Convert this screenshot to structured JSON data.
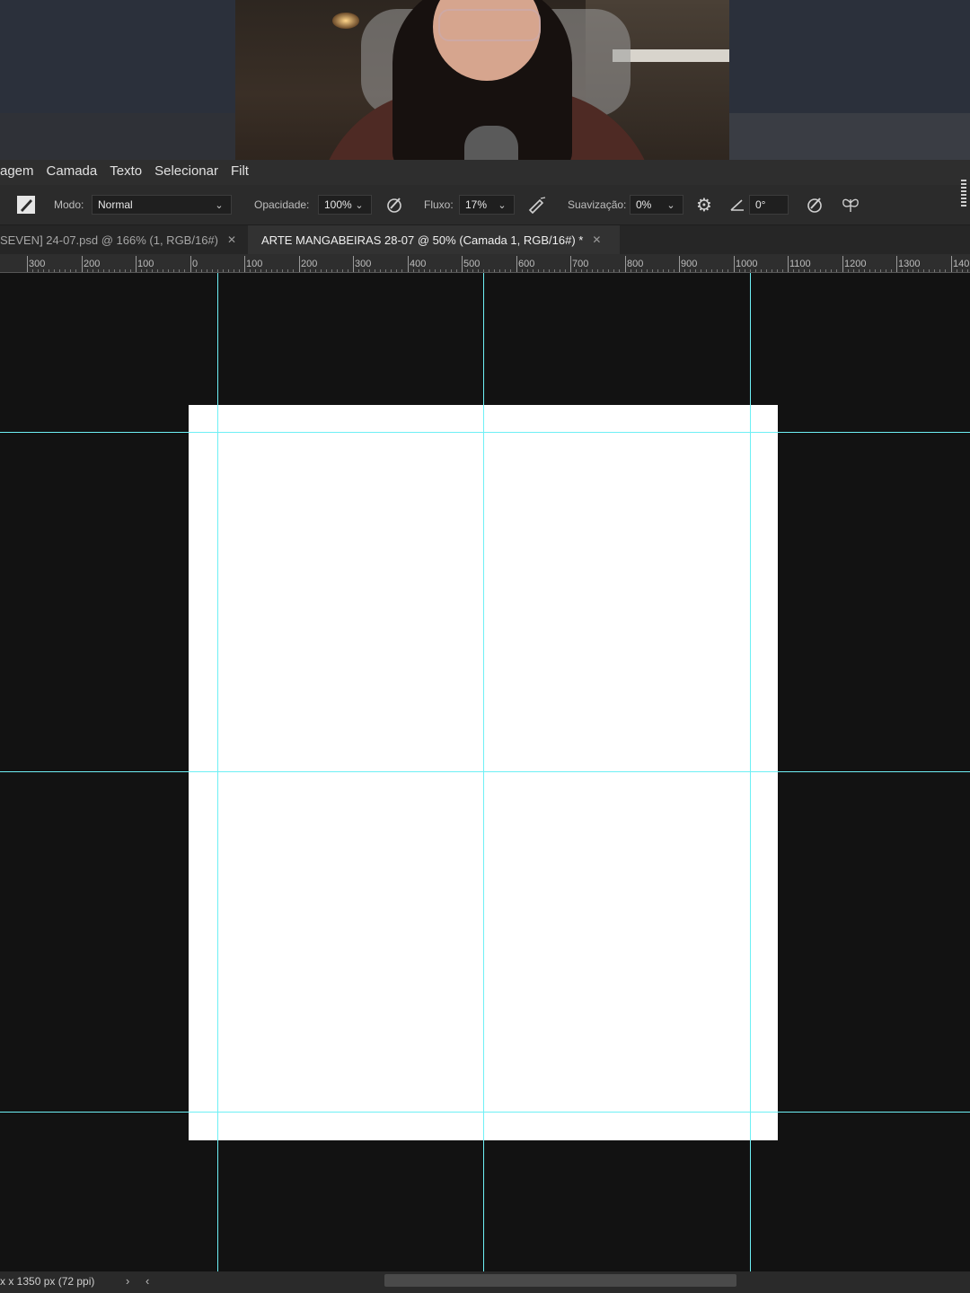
{
  "menu": {
    "items": [
      "agem",
      "Camada",
      "Texto",
      "Selecionar",
      "Filt"
    ]
  },
  "options": {
    "mode_label": "Modo:",
    "mode_value": "Normal",
    "opacity_label": "Opacidade:",
    "opacity_value": "100%",
    "flow_label": "Fluxo:",
    "flow_value": "17%",
    "smoothing_label": "Suavização:",
    "smoothing_value": "0%",
    "angle_value": "0°"
  },
  "tabs": [
    {
      "label": "SEVEN] 24-07.psd @ 166% (1, RGB/16#)",
      "active": false
    },
    {
      "label": "ARTE MANGABEIRAS 28-07 @ 50% (Camada 1, RGB/16#) *",
      "active": true
    }
  ],
  "ruler": {
    "labels": [
      "300",
      "200",
      "100",
      "0",
      "100",
      "200",
      "300",
      "400",
      "500",
      "600",
      "700",
      "800",
      "900",
      "1000",
      "1100",
      "1200",
      "1300",
      "140"
    ]
  },
  "status": {
    "doc_info": "x x 1350 px (72 ppi)",
    "next": "›",
    "prev": "‹"
  },
  "colors": {
    "guide": "#6ef0f5",
    "canvas_bg": "#121212",
    "document": "#ffffff"
  }
}
